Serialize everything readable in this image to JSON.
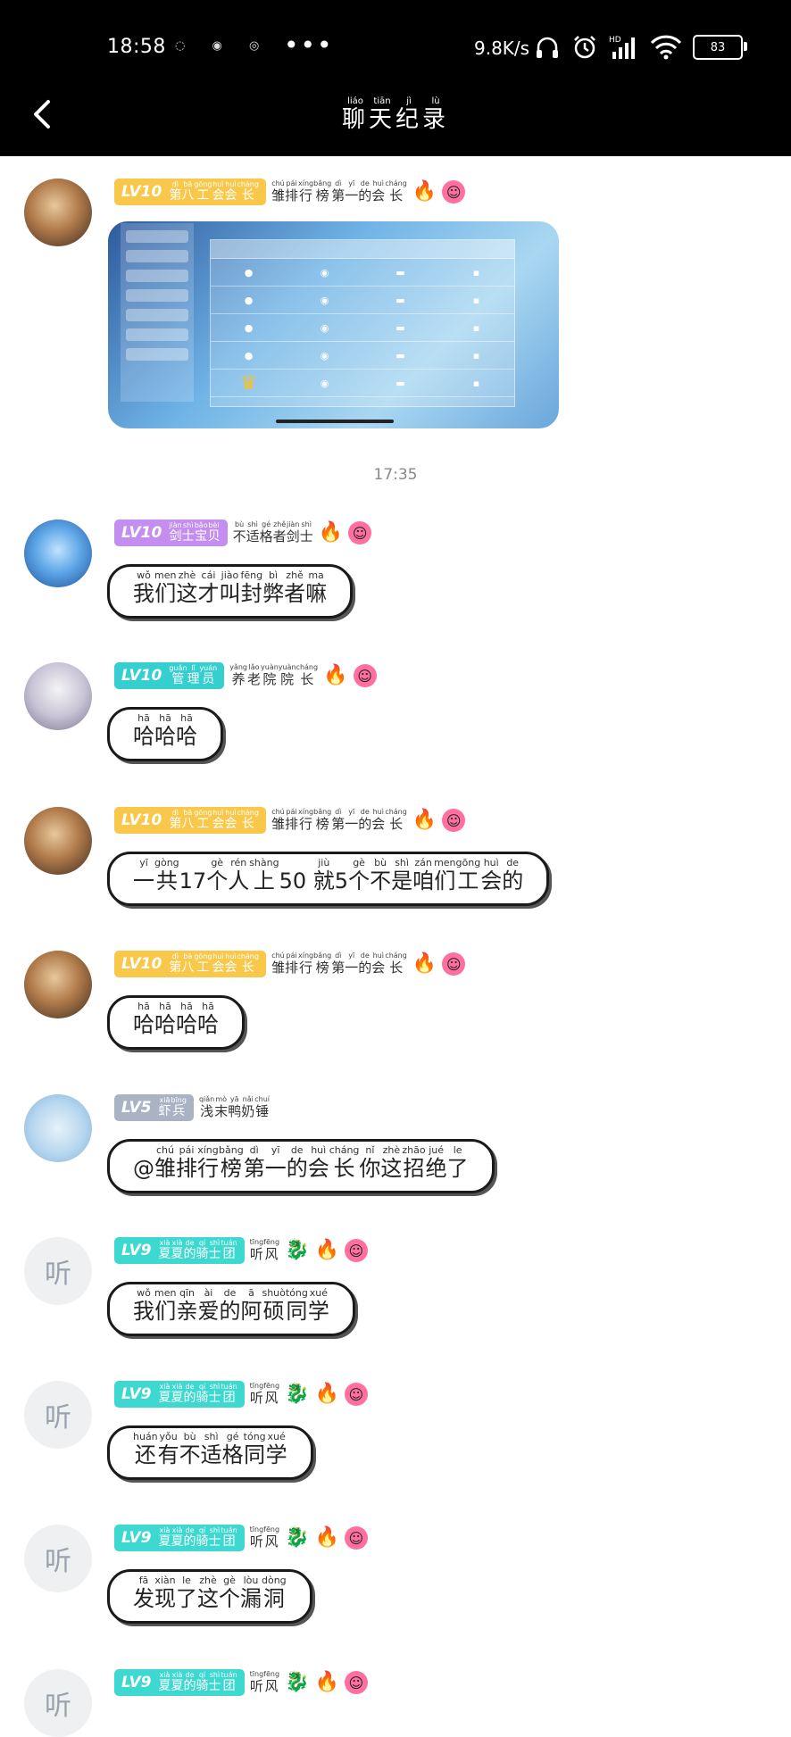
{
  "status": {
    "time": "18:58",
    "speed": "9.8K/s",
    "battery": "83"
  },
  "header": {
    "title_chars": [
      {
        "c": "聊",
        "p": "liáo"
      },
      {
        "c": "天",
        "p": "tiān"
      },
      {
        "c": "纪",
        "p": "jì"
      },
      {
        "c": "录",
        "p": "lù"
      }
    ]
  },
  "colors": {
    "lv10_gold": "#f9c84a",
    "lv10_purple": "#c48ef0",
    "lv10_teal": "#35cfcf",
    "lv5_gray": "#a9b3c4",
    "lv9_teal": "#3dd8cf"
  },
  "separator_time": "17:35",
  "messages": [
    {
      "lv": "LV10",
      "role": [
        {
          "c": "第",
          "p": "dì"
        },
        {
          "c": "八",
          "p": "bā"
        },
        {
          "c": "工",
          "p": "gōng"
        },
        {
          "c": "会",
          "p": "huì"
        },
        {
          "c": "会",
          "p": "huì"
        },
        {
          "c": "长",
          "p": "cháng"
        }
      ],
      "nick": [
        {
          "c": "雏",
          "p": "chú"
        },
        {
          "c": "排",
          "p": "pái"
        },
        {
          "c": "行",
          "p": "xíng"
        },
        {
          "c": "榜",
          "p": "bǎng"
        },
        {
          "c": "第",
          "p": "dì"
        },
        {
          "c": "一",
          "p": "yī"
        },
        {
          "c": "的",
          "p": "de"
        },
        {
          "c": "会",
          "p": "huì"
        },
        {
          "c": "长",
          "p": "cháng"
        }
      ],
      "image": true
    },
    {
      "lv": "LV10",
      "role": [
        {
          "c": "剑",
          "p": "jiàn"
        },
        {
          "c": "士",
          "p": "shì"
        },
        {
          "c": "宝",
          "p": "bǎo"
        },
        {
          "c": "贝",
          "p": "bèi"
        }
      ],
      "nick": [
        {
          "c": "不",
          "p": "bù"
        },
        {
          "c": "适",
          "p": "shì"
        },
        {
          "c": "格",
          "p": "gé"
        },
        {
          "c": "者",
          "p": "zhě"
        },
        {
          "c": "剑",
          "p": "jiàn"
        },
        {
          "c": "士",
          "p": "shì"
        }
      ],
      "text": [
        {
          "c": "我",
          "p": "wǒ"
        },
        {
          "c": "们",
          "p": "men"
        },
        {
          "c": "这",
          "p": "zhè"
        },
        {
          "c": "才",
          "p": "cái"
        },
        {
          "c": "叫",
          "p": "jiào"
        },
        {
          "c": "封",
          "p": "fēng"
        },
        {
          "c": "弊",
          "p": "bì"
        },
        {
          "c": "者",
          "p": "zhě"
        },
        {
          "c": "嘛",
          "p": "ma"
        }
      ]
    },
    {
      "lv": "LV10",
      "role": [
        {
          "c": "管",
          "p": "guǎn"
        },
        {
          "c": "理",
          "p": "lǐ"
        },
        {
          "c": "员",
          "p": "yuán"
        }
      ],
      "nick": [
        {
          "c": "养",
          "p": "yǎng"
        },
        {
          "c": "老",
          "p": "lǎo"
        },
        {
          "c": "院",
          "p": "yuàn"
        },
        {
          "c": "院",
          "p": "yuàn"
        },
        {
          "c": "长",
          "p": "cháng"
        }
      ],
      "text": [
        {
          "c": "哈",
          "p": "hā"
        },
        {
          "c": "哈",
          "p": "hā"
        },
        {
          "c": "哈",
          "p": "hā"
        }
      ]
    },
    {
      "lv": "LV10",
      "role": [
        {
          "c": "第",
          "p": "dì"
        },
        {
          "c": "八",
          "p": "bā"
        },
        {
          "c": "工",
          "p": "gōng"
        },
        {
          "c": "会",
          "p": "huì"
        },
        {
          "c": "会",
          "p": "huì"
        },
        {
          "c": "长",
          "p": "cháng"
        }
      ],
      "nick": [
        {
          "c": "雏",
          "p": "chú"
        },
        {
          "c": "排",
          "p": "pái"
        },
        {
          "c": "行",
          "p": "xíng"
        },
        {
          "c": "榜",
          "p": "bǎng"
        },
        {
          "c": "第",
          "p": "dì"
        },
        {
          "c": "一",
          "p": "yī"
        },
        {
          "c": "的",
          "p": "de"
        },
        {
          "c": "会",
          "p": "huì"
        },
        {
          "c": "长",
          "p": "cháng"
        }
      ],
      "text": [
        {
          "c": "一",
          "p": "yī"
        },
        {
          "c": "共",
          "p": "gòng"
        },
        {
          "c": "17",
          "p": ""
        },
        {
          "c": "个",
          "p": "gè"
        },
        {
          "c": "人",
          "p": "rén"
        },
        {
          "c": "上",
          "p": "shàng"
        },
        {
          "c": "50",
          "p": ""
        },
        {
          "c": " ",
          "p": ""
        },
        {
          "c": "就",
          "p": "jiù"
        },
        {
          "c": "5",
          "p": ""
        },
        {
          "c": "个",
          "p": "gè"
        },
        {
          "c": "不",
          "p": "bù"
        },
        {
          "c": "是",
          "p": "shì"
        },
        {
          "c": "咱",
          "p": "zán"
        },
        {
          "c": "们",
          "p": "men"
        },
        {
          "c": "工",
          "p": "gōng"
        },
        {
          "c": "会",
          "p": "huì"
        },
        {
          "c": "的",
          "p": "de"
        }
      ]
    },
    {
      "lv": "LV10",
      "role": [
        {
          "c": "第",
          "p": "dì"
        },
        {
          "c": "八",
          "p": "bā"
        },
        {
          "c": "工",
          "p": "gōng"
        },
        {
          "c": "会",
          "p": "huì"
        },
        {
          "c": "会",
          "p": "huì"
        },
        {
          "c": "长",
          "p": "cháng"
        }
      ],
      "nick": [
        {
          "c": "雏",
          "p": "chú"
        },
        {
          "c": "排",
          "p": "pái"
        },
        {
          "c": "行",
          "p": "xíng"
        },
        {
          "c": "榜",
          "p": "bǎng"
        },
        {
          "c": "第",
          "p": "dì"
        },
        {
          "c": "一",
          "p": "yī"
        },
        {
          "c": "的",
          "p": "de"
        },
        {
          "c": "会",
          "p": "huì"
        },
        {
          "c": "长",
          "p": "cháng"
        }
      ],
      "text": [
        {
          "c": "哈",
          "p": "hā"
        },
        {
          "c": "哈",
          "p": "hā"
        },
        {
          "c": "哈",
          "p": "hā"
        },
        {
          "c": "哈",
          "p": "hā"
        }
      ]
    },
    {
      "lv": "LV5",
      "role": [
        {
          "c": "虾",
          "p": "xiā"
        },
        {
          "c": "兵",
          "p": "bīng"
        }
      ],
      "nick": [
        {
          "c": "浅",
          "p": "qiǎn"
        },
        {
          "c": "末",
          "p": "mò"
        },
        {
          "c": "鸭",
          "p": "yā"
        },
        {
          "c": "奶",
          "p": "nǎi"
        },
        {
          "c": "锤",
          "p": "chuí"
        }
      ],
      "text": [
        {
          "c": "@",
          "p": ""
        },
        {
          "c": "雏",
          "p": "chú"
        },
        {
          "c": "排",
          "p": "pái"
        },
        {
          "c": "行",
          "p": "xíng"
        },
        {
          "c": "榜",
          "p": "bǎng"
        },
        {
          "c": "第",
          "p": "dì"
        },
        {
          "c": "一",
          "p": "yī"
        },
        {
          "c": "的",
          "p": "de"
        },
        {
          "c": "会",
          "p": "huì"
        },
        {
          "c": "长",
          "p": "cháng"
        },
        {
          "c": "你",
          "p": "nǐ"
        },
        {
          "c": "这",
          "p": "zhè"
        },
        {
          "c": "招",
          "p": "zhāo"
        },
        {
          "c": "绝",
          "p": "jué"
        },
        {
          "c": "了",
          "p": "le"
        }
      ]
    },
    {
      "lv": "LV9",
      "role": [
        {
          "c": "夏",
          "p": "xià"
        },
        {
          "c": "夏",
          "p": "xià"
        },
        {
          "c": "的",
          "p": "de"
        },
        {
          "c": "骑",
          "p": "qí"
        },
        {
          "c": "士",
          "p": "shì"
        },
        {
          "c": "团",
          "p": "tuán"
        }
      ],
      "nick": [
        {
          "c": "听",
          "p": "tīng"
        },
        {
          "c": "风",
          "p": "fēng"
        }
      ],
      "text": [
        {
          "c": "我",
          "p": "wǒ"
        },
        {
          "c": "们",
          "p": "men"
        },
        {
          "c": "亲",
          "p": "qīn"
        },
        {
          "c": "爱",
          "p": "ài"
        },
        {
          "c": "的",
          "p": "de"
        },
        {
          "c": "阿",
          "p": "ā"
        },
        {
          "c": "硕",
          "p": "shuò"
        },
        {
          "c": "同",
          "p": "tóng"
        },
        {
          "c": "学",
          "p": "xué"
        }
      ]
    },
    {
      "lv": "LV9",
      "role": [
        {
          "c": "夏",
          "p": "xià"
        },
        {
          "c": "夏",
          "p": "xià"
        },
        {
          "c": "的",
          "p": "de"
        },
        {
          "c": "骑",
          "p": "qí"
        },
        {
          "c": "士",
          "p": "shì"
        },
        {
          "c": "团",
          "p": "tuán"
        }
      ],
      "nick": [
        {
          "c": "听",
          "p": "tīng"
        },
        {
          "c": "风",
          "p": "fēng"
        }
      ],
      "text": [
        {
          "c": "还",
          "p": "huán"
        },
        {
          "c": "有",
          "p": "yǒu"
        },
        {
          "c": "不",
          "p": "bù"
        },
        {
          "c": "适",
          "p": "shì"
        },
        {
          "c": "格",
          "p": "gé"
        },
        {
          "c": "同",
          "p": "tóng"
        },
        {
          "c": "学",
          "p": "xué"
        }
      ]
    },
    {
      "lv": "LV9",
      "role": [
        {
          "c": "夏",
          "p": "xià"
        },
        {
          "c": "夏",
          "p": "xià"
        },
        {
          "c": "的",
          "p": "de"
        },
        {
          "c": "骑",
          "p": "qí"
        },
        {
          "c": "士",
          "p": "shì"
        },
        {
          "c": "团",
          "p": "tuán"
        }
      ],
      "nick": [
        {
          "c": "听",
          "p": "tīng"
        },
        {
          "c": "风",
          "p": "fēng"
        }
      ],
      "text": [
        {
          "c": "发",
          "p": "fā"
        },
        {
          "c": "现",
          "p": "xiàn"
        },
        {
          "c": "了",
          "p": "le"
        },
        {
          "c": "这",
          "p": "zhè"
        },
        {
          "c": "个",
          "p": "gè"
        },
        {
          "c": "漏",
          "p": "lòu"
        },
        {
          "c": "洞",
          "p": "dòng"
        }
      ]
    },
    {
      "lv": "LV9",
      "role": [
        {
          "c": "夏",
          "p": "xià"
        },
        {
          "c": "夏",
          "p": "xià"
        },
        {
          "c": "的",
          "p": "de"
        },
        {
          "c": "骑",
          "p": "qí"
        },
        {
          "c": "士",
          "p": "shì"
        },
        {
          "c": "团",
          "p": "tuán"
        }
      ],
      "nick": [
        {
          "c": "听",
          "p": "tīng"
        },
        {
          "c": "风",
          "p": "fēng"
        }
      ]
    }
  ]
}
